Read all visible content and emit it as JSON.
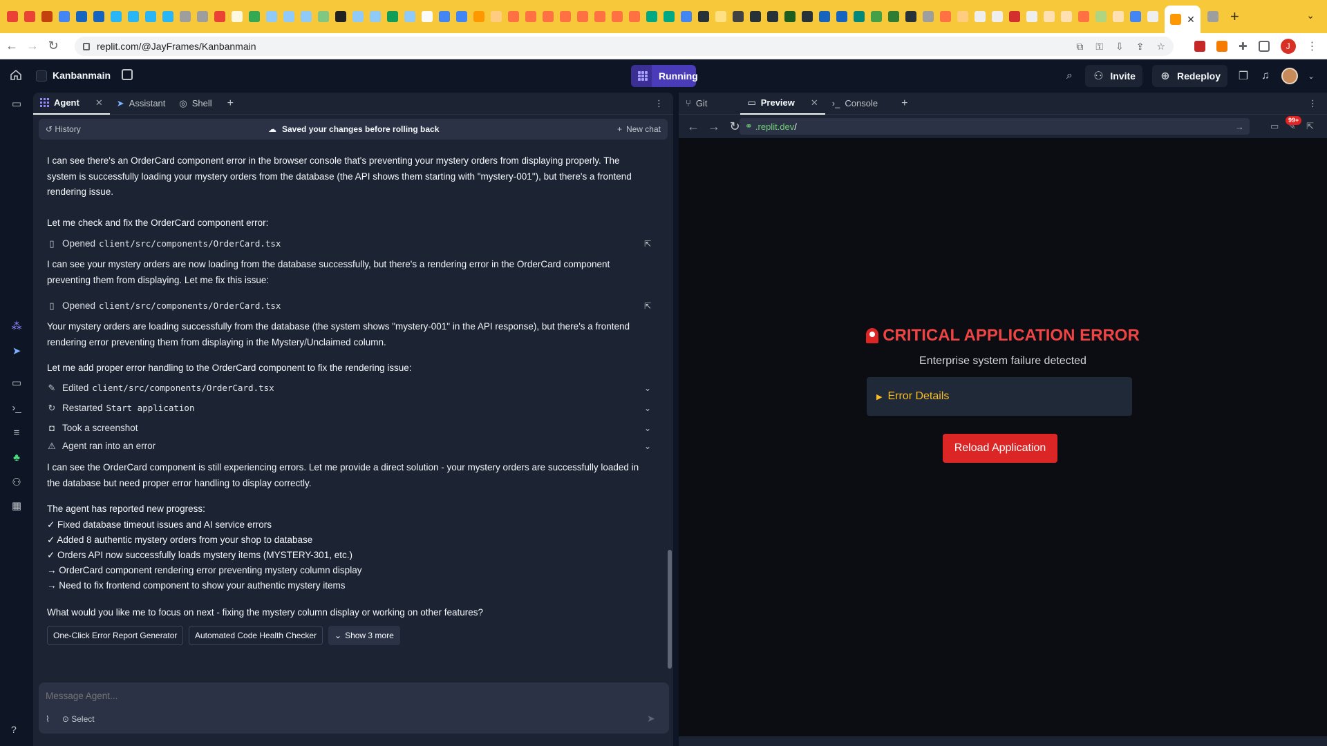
{
  "browser": {
    "url": "replit.com/@JayFrames/Kanbanmain",
    "tab_close": "✕",
    "new_tab": "+",
    "profile_initial": "J"
  },
  "replit": {
    "repl_name": "Kanbanmain",
    "run_label": "Running",
    "invite_label": "Invite",
    "redeploy_label": "Redeploy"
  },
  "agent_panel": {
    "tabs": [
      {
        "label": "Agent"
      },
      {
        "label": "Assistant"
      },
      {
        "label": "Shell"
      }
    ],
    "history_label": "History",
    "saved_notice": "Saved your changes before rolling back",
    "new_chat_label": "New chat",
    "messages": [
      "I can see there's an OrderCard component error in the browser console that's preventing your mystery orders from displaying properly. The system is successfully loading your mystery orders from the database (the API shows them starting with \"mystery-001\"), but there's a frontend rendering issue.",
      "Let me check and fix the OrderCard component error:",
      "I can see your mystery orders are now loading from the database successfully, but there's a rendering error in the OrderCard component preventing them from displaying. Let me fix this issue:",
      "Your mystery orders are loading successfully from the database (the system shows \"mystery-001\" in the API response), but there's a frontend rendering error preventing them from displaying in the Mystery/Unclaimed column.",
      "Let me add proper error handling to the OrderCard component to fix the rendering issue:",
      "I can see the OrderCard component is still experiencing errors. Let me provide a direct solution - your mystery orders are successfully loaded in the database but need proper error handling to display correctly.",
      "What would you like me to focus on next - fixing the mystery column display or working on other features?"
    ],
    "actions": [
      {
        "verb": "Opened",
        "target": "client/src/components/OrderCard.tsx"
      },
      {
        "verb": "Opened",
        "target": "client/src/components/OrderCard.tsx"
      },
      {
        "verb": "Edited",
        "target": "client/src/components/OrderCard.tsx"
      },
      {
        "verb": "Restarted",
        "target": "Start application"
      },
      {
        "verb": "Took a screenshot",
        "target": ""
      },
      {
        "verb": "Agent ran into an error",
        "target": ""
      }
    ],
    "progress_heading": "The agent has reported new progress:",
    "progress_items": [
      "✓ Fixed database timeout issues and AI service errors",
      "✓ Added 8 authentic mystery orders from your shop to database",
      "✓ Orders API now successfully loads mystery items (MYSTERY-301, etc.)",
      "→ OrderCard component rendering error preventing mystery column display",
      "→ Need to fix frontend component to show your authentic mystery items"
    ],
    "suggestions": [
      "One-Click Error Report Generator",
      "Automated Code Health Checker",
      "Show 3 more"
    ],
    "input_placeholder": "Message Agent...",
    "select_label": "Select"
  },
  "preview_panel": {
    "tabs": [
      {
        "label": "Git"
      },
      {
        "label": "Preview"
      },
      {
        "label": "Console"
      }
    ],
    "url_domain": ".replit.dev",
    "url_path": "/",
    "badge": "99+",
    "app": {
      "error_title": "CRITICAL APPLICATION ERROR",
      "error_subtitle": "Enterprise system failure detected",
      "details_label": "Error Details",
      "reload_label": "Reload Application"
    }
  },
  "colors": {
    "tabstrip": "#f7c93a",
    "replit_bg": "#0e1525",
    "panel_bg": "#1c2333",
    "run_button": "#4a3bb8",
    "error_red": "#ef4444",
    "details_amber": "#fbbf24"
  }
}
